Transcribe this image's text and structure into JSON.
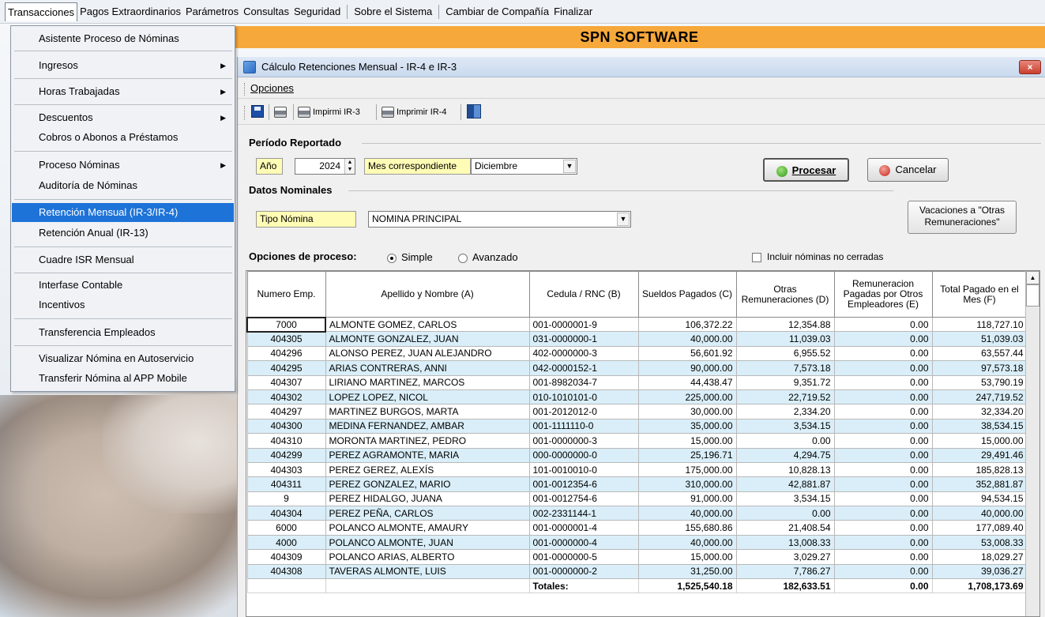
{
  "menubar": {
    "items": [
      "Transacciones",
      "Pagos Extraordinarios",
      "Parámetros",
      "Consultas",
      "Seguridad",
      "Sobre el Sistema",
      "Cambiar de Compañía",
      "Finalizar"
    ]
  },
  "banner": {
    "title": "SPN SOFTWARE"
  },
  "dropdown": {
    "items": [
      {
        "label": "Asistente Proceso de Nóminas"
      },
      {
        "label": "Ingresos"
      },
      {
        "label": "Horas Trabajadas"
      },
      {
        "label": "Descuentos"
      },
      {
        "label": "Cobros o Abonos a Préstamos"
      },
      {
        "label": "Proceso Nóminas"
      },
      {
        "label": "Auditoría de Nóminas"
      },
      {
        "label": "Retención Mensual  (IR-3/IR-4)"
      },
      {
        "label": "Retención Anual  (IR-13)"
      },
      {
        "label": "Cuadre ISR Mensual"
      },
      {
        "label": "Interfase Contable"
      },
      {
        "label": "Incentivos"
      },
      {
        "label": "Transferencia Empleados"
      },
      {
        "label": "Visualizar Nómina en Autoservicio"
      },
      {
        "label": "Transferir Nómina al APP Mobile"
      }
    ]
  },
  "window": {
    "title": "Cálculo Retenciones Mensual - IR-4 e IR-3",
    "close_label": "×",
    "menu_opciones": "Opciones",
    "tb_imprimir_ir3": "Impirmi IR-3",
    "tb_imprimir_ir4": "Imprimir IR-4"
  },
  "periodo": {
    "section": "Período Reportado",
    "anio_label": "Año",
    "anio_value": "2024",
    "mes_label": "Mes correspondiente",
    "mes_value": "Diciembre"
  },
  "nominales": {
    "section": "Datos Nominales",
    "tipo_label": "Tipo Nómina",
    "tipo_value": "NOMINA PRINCIPAL"
  },
  "buttons": {
    "procesar": "Procesar",
    "cancelar": "Cancelar",
    "vacaciones_line1": "Vacaciones a \"Otras",
    "vacaciones_line2": "Remuneraciones\""
  },
  "opciones_proceso": {
    "label": "Opciones de proceso:",
    "simple": "Simple",
    "avanzado": "Avanzado",
    "incluir": "Incluir nóminas no cerradas"
  },
  "table": {
    "headers": [
      "Numero Emp.",
      "Apellido y Nombre (A)",
      "Cedula / RNC (B)",
      "Sueldos Pagados (C)",
      "Otras Remuneraciones (D)",
      "Remuneracion Pagadas por Otros Empleadores (E)",
      "Total Pagado en el Mes (F)"
    ],
    "rows": [
      [
        "7000",
        "ALMONTE GOMEZ, CARLOS",
        "001-0000001-9",
        "106,372.22",
        "12,354.88",
        "0.00",
        "118,727.10"
      ],
      [
        "404305",
        "ALMONTE GONZALEZ, JUAN",
        "031-0000000-1",
        "40,000.00",
        "11,039.03",
        "0.00",
        "51,039.03"
      ],
      [
        "404296",
        "ALONSO PEREZ, JUAN ALEJANDRO",
        "402-0000000-3",
        "56,601.92",
        "6,955.52",
        "0.00",
        "63,557.44"
      ],
      [
        "404295",
        "ARIAS CONTRERAS, ANNI",
        "042-0000152-1",
        "90,000.00",
        "7,573.18",
        "0.00",
        "97,573.18"
      ],
      [
        "404307",
        "LIRIANO MARTINEZ, MARCOS",
        "001-8982034-7",
        "44,438.47",
        "9,351.72",
        "0.00",
        "53,790.19"
      ],
      [
        "404302",
        "LOPEZ LOPEZ, NICOL",
        "010-1010101-0",
        "225,000.00",
        "22,719.52",
        "0.00",
        "247,719.52"
      ],
      [
        "404297",
        "MARTINEZ BURGOS, MARTA",
        "001-2012012-0",
        "30,000.00",
        "2,334.20",
        "0.00",
        "32,334.20"
      ],
      [
        "404300",
        "MEDINA FERNANDEZ, AMBAR",
        "001-1111110-0",
        "35,000.00",
        "3,534.15",
        "0.00",
        "38,534.15"
      ],
      [
        "404310",
        "MORONTA MARTINEZ, PEDRO",
        "001-0000000-3",
        "15,000.00",
        "0.00",
        "0.00",
        "15,000.00"
      ],
      [
        "404299",
        "PEREZ AGRAMONTE, MARIA",
        "000-0000000-0",
        "25,196.71",
        "4,294.75",
        "0.00",
        "29,491.46"
      ],
      [
        "404303",
        "PEREZ GEREZ, ALEXÍS",
        "101-0010010-0",
        "175,000.00",
        "10,828.13",
        "0.00",
        "185,828.13"
      ],
      [
        "404311",
        "PEREZ GONZALEZ, MARIO",
        "001-0012354-6",
        "310,000.00",
        "42,881.87",
        "0.00",
        "352,881.87"
      ],
      [
        "9",
        "PEREZ HIDALGO, JUANA",
        "001-0012754-6",
        "91,000.00",
        "3,534.15",
        "0.00",
        "94,534.15"
      ],
      [
        "404304",
        "PEREZ PEÑA, CARLOS",
        "002-2331144-1",
        "40,000.00",
        "0.00",
        "0.00",
        "40,000.00"
      ],
      [
        "6000",
        "POLANCO ALMONTE, AMAURY",
        "001-0000001-4",
        "155,680.86",
        "21,408.54",
        "0.00",
        "177,089.40"
      ],
      [
        "4000",
        "POLANCO ALMONTE, JUAN",
        "001-0000000-4",
        "40,000.00",
        "13,008.33",
        "0.00",
        "53,008.33"
      ],
      [
        "404309",
        "POLANCO ARIAS, ALBERTO",
        "001-0000000-5",
        "15,000.00",
        "3,029.27",
        "0.00",
        "18,029.27"
      ],
      [
        "404308",
        "TAVERAS ALMONTE, LUIS",
        "001-0000000-2",
        "31,250.00",
        "7,786.27",
        "0.00",
        "39,036.27"
      ]
    ],
    "totals": {
      "label": "Totales:",
      "sueldos": "1,525,540.18",
      "otras": "182,633.51",
      "otros_empleadores": "0.00",
      "total": "1,708,173.69"
    }
  }
}
